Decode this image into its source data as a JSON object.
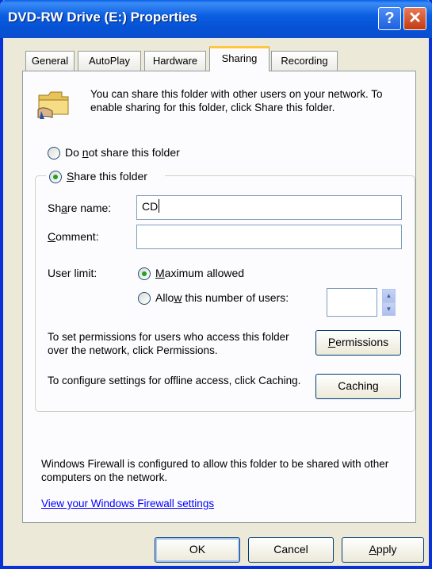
{
  "window": {
    "title": "DVD-RW Drive (E:) Properties",
    "help_glyph": "?",
    "close_glyph": "✕"
  },
  "tabs": [
    {
      "label": "General",
      "active": false
    },
    {
      "label": "AutoPlay",
      "active": false
    },
    {
      "label": "Hardware",
      "active": false
    },
    {
      "label": "Sharing",
      "active": true
    },
    {
      "label": "Recording",
      "active": false
    }
  ],
  "sharing": {
    "intro_text": "You can share this folder with other users on your network.  To enable sharing for this folder, click Share this folder.",
    "icon": "folder-share-icon",
    "do_not_share": {
      "pre": "Do ",
      "key": "n",
      "post": "ot share this folder",
      "checked": false
    },
    "share": {
      "pre": "",
      "key": "S",
      "post": "hare this folder",
      "checked": true
    },
    "share_name_label": {
      "pre": "Sh",
      "key": "a",
      "post": "re name:"
    },
    "share_name_value": "CD",
    "comment_label": {
      "pre": "",
      "key": "C",
      "post": "omment:"
    },
    "comment_value": "",
    "user_limit_label": "User limit:",
    "max_allowed": {
      "pre": "",
      "key": "M",
      "post": "aximum allowed",
      "checked": true
    },
    "allow_number": {
      "pre": "Allo",
      "key": "w",
      "post": " this number of users:",
      "checked": false
    },
    "user_count_value": "",
    "permissions_text": "To set permissions for users who access this folder over the network, click Permissions.",
    "permissions_button": {
      "pre": "",
      "key": "P",
      "post": "ermissions"
    },
    "caching_text": "To configure settings for offline access, click Caching.",
    "caching_button": {
      "pre": "Cachin",
      "key": "g",
      "post": ""
    },
    "firewall_text": "Windows Firewall is configured to allow this folder to be shared with other computers on the network.",
    "firewall_link": "View your Windows Firewall settings"
  },
  "footer": {
    "ok": "OK",
    "cancel": "Cancel",
    "apply": {
      "pre": "",
      "key": "A",
      "post": "pply"
    }
  }
}
